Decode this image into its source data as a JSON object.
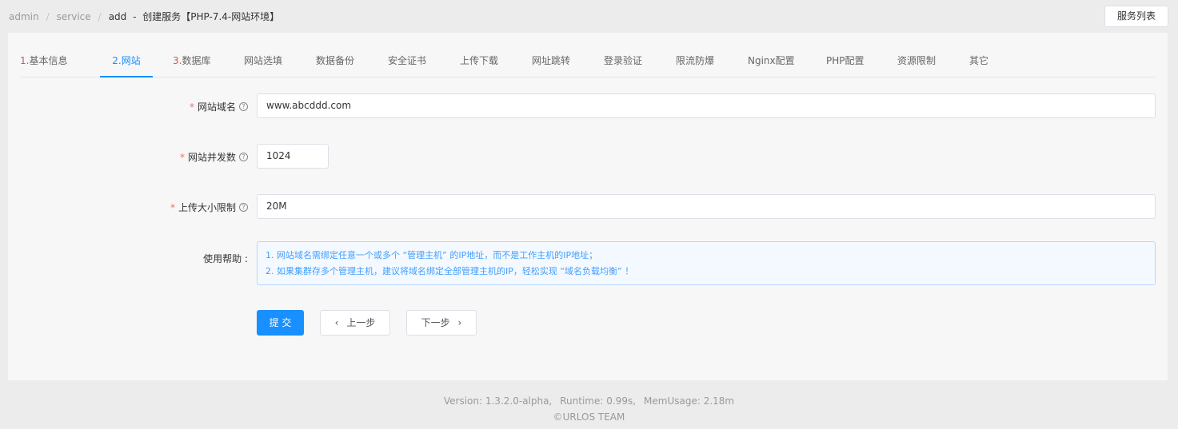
{
  "breadcrumb": {
    "items": [
      "admin",
      "service",
      "add"
    ],
    "separator": "/",
    "dash": "-",
    "title": "创建服务【PHP-7.4-网站环境】"
  },
  "header": {
    "service_list_label": "服务列表"
  },
  "tabs": [
    {
      "num": "1.",
      "label": "基本信息"
    },
    {
      "num": "2.",
      "label": "网站"
    },
    {
      "num": "3.",
      "label": "数据库"
    },
    {
      "num": "",
      "label": "网站选填"
    },
    {
      "num": "",
      "label": "数据备份"
    },
    {
      "num": "",
      "label": "安全证书"
    },
    {
      "num": "",
      "label": "上传下载"
    },
    {
      "num": "",
      "label": "网址跳转"
    },
    {
      "num": "",
      "label": "登录验证"
    },
    {
      "num": "",
      "label": "限流防爆"
    },
    {
      "num": "",
      "label": "Nginx配置"
    },
    {
      "num": "",
      "label": "PHP配置"
    },
    {
      "num": "",
      "label": "资源限制"
    },
    {
      "num": "",
      "label": "其它"
    }
  ],
  "active_tab": "网站",
  "form": {
    "required_mark": "*",
    "help_mark": "?",
    "domain": {
      "label": "网站域名",
      "value": "www.abcddd.com"
    },
    "concurrency": {
      "label": "网站并发数",
      "value": "1024"
    },
    "upload_limit": {
      "label": "上传大小限制",
      "value": "20M"
    },
    "usage_help": {
      "label": "使用帮助 :",
      "lines": [
        "1. 网站域名需绑定任意一个或多个 “管理主机” 的IP地址，而不是工作主机的IP地址；",
        "2. 如果集群存多个管理主机，建议将域名绑定全部管理主机的IP，轻松实现 “域名负载均衡” ！"
      ]
    }
  },
  "buttons": {
    "submit": "提 交",
    "prev": "上一步",
    "next": "下一步",
    "prev_icon": "chevron-left-icon",
    "next_icon": "chevron-right-icon"
  },
  "footer": {
    "version": "Version: 1.3.2.0-alpha,",
    "runtime": "Runtime: 0.99s,",
    "mem": "MemUsage: 2.18m",
    "copyright": "©URLOS TEAM"
  },
  "colors": {
    "accent": "#1890ff",
    "required": "#f56c6c",
    "tab_number": "#d9534f",
    "help_text": "#409eff"
  }
}
